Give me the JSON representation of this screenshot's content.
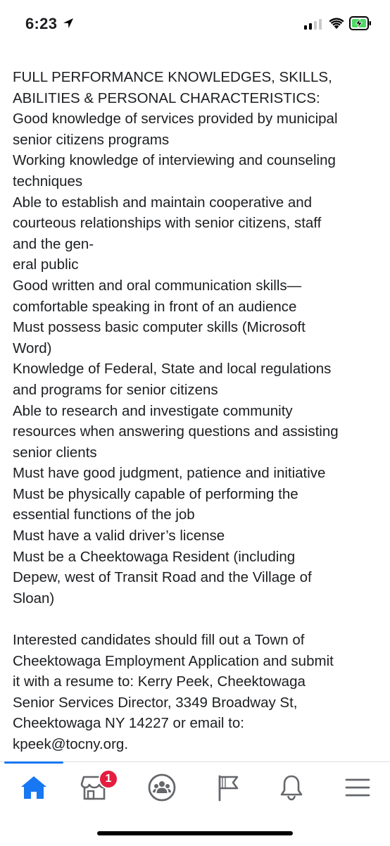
{
  "status_bar": {
    "time": "6:23",
    "icons": [
      "location-arrow-icon",
      "cellular-signal-icon",
      "wifi-icon",
      "battery-charging-icon"
    ],
    "battery_color": "#4cd964"
  },
  "post": {
    "lines": [
      "FULL PERFORMANCE KNOWLEDGES, SKILLS,",
      "ABILITIES & PERSONAL CHARACTERISTICS:",
      "Good knowledge of services provided by municipal",
      "senior citizens programs",
      "Working knowledge of interviewing and counseling",
      "techniques",
      "Able to establish and maintain cooperative and",
      "courteous relationships with senior citizens, staff",
      "and the gen-",
      "eral public",
      "Good written and oral communication skills—",
      "comfortable speaking in front of an audience",
      "Must possess basic computer skills (Microsoft",
      "Word)",
      "Knowledge of Federal, State and local regulations",
      "and programs for senior citizens",
      "Able to research and investigate community",
      "resources when answering questions and assisting",
      "senior clients",
      "Must have good judgment, patience and initiative",
      "Must be physically capable of performing the",
      "essential functions of the job",
      "Must have a valid driver’s license",
      "Must be a Cheektowaga Resident (including",
      "Depew, west of Transit Road and the Village of",
      "Sloan)",
      "",
      "Interested candidates should fill out a Town of",
      "Cheektowaga Employment Application and submit",
      "it with a resume to: Kerry Peek, Cheektowaga",
      "Senior Services Director, 3349 Broadway St,",
      "Cheektowaga NY 14227 or email to:",
      "kpeek@tocny.org."
    ]
  },
  "tab_bar": {
    "accent": "#1877f2",
    "badge_color": "#e41e3f",
    "tabs": [
      {
        "icon": "home-icon",
        "active": true
      },
      {
        "icon": "marketplace-icon",
        "badge": "1"
      },
      {
        "icon": "groups-icon"
      },
      {
        "icon": "pages-flag-icon"
      },
      {
        "icon": "notifications-bell-icon"
      },
      {
        "icon": "menu-icon"
      }
    ]
  }
}
